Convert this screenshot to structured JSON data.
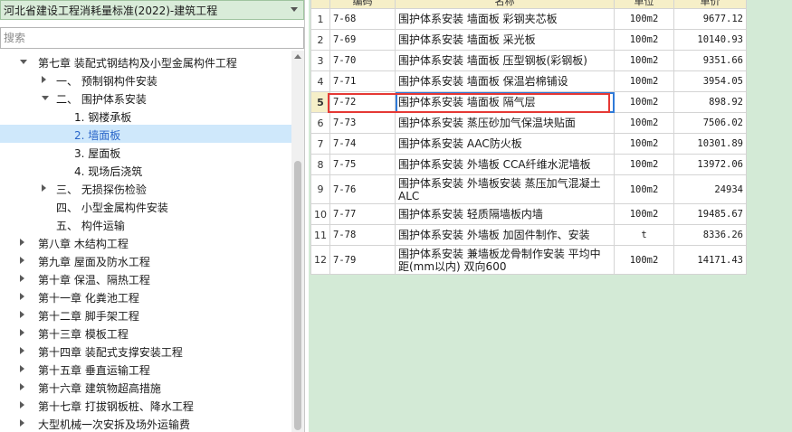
{
  "standard_select": {
    "value": "河北省建设工程消耗量标准(2022)-建筑工程"
  },
  "search": {
    "placeholder": "搜索"
  },
  "tree": [
    {
      "label": "第七章 装配式钢结构及小型金属构件工程",
      "expanded": true
    },
    {
      "label": "一、 预制钢构件安装",
      "expanded": false
    },
    {
      "label": "二、 围护体系安装",
      "expanded": true
    },
    {
      "label": "1. 钢楼承板"
    },
    {
      "label": "2. 墙面板",
      "selected": true
    },
    {
      "label": "3. 屋面板"
    },
    {
      "label": "4. 现场后浇筑"
    },
    {
      "label": "三、 无损探伤检验",
      "expanded": false
    },
    {
      "label": "四、 小型金属构件安装"
    },
    {
      "label": "五、 构件运输"
    },
    {
      "label": "第八章 木结构工程",
      "expanded": false
    },
    {
      "label": "第九章 屋面及防水工程",
      "expanded": false
    },
    {
      "label": "第十章 保温、隔热工程",
      "expanded": false
    },
    {
      "label": "第十一章 化粪池工程",
      "expanded": false
    },
    {
      "label": "第十二章 脚手架工程",
      "expanded": false
    },
    {
      "label": "第十三章 模板工程",
      "expanded": false
    },
    {
      "label": "第十四章 装配式支撑安装工程",
      "expanded": false
    },
    {
      "label": "第十五章 垂直运输工程",
      "expanded": false
    },
    {
      "label": "第十六章 建筑物超高措施",
      "expanded": false
    },
    {
      "label": "第十七章 打拔钢板桩、降水工程",
      "expanded": false
    },
    {
      "label": "大型机械一次安拆及场外运输费",
      "expanded": false
    }
  ],
  "table": {
    "headers": {
      "code": "编码",
      "name": "名称",
      "unit": "单位",
      "price": "单价"
    },
    "rows": [
      {
        "idx": "1",
        "code": "7-68",
        "name": "围护体系安装 墙面板 彩钢夹芯板",
        "unit": "100m2",
        "price": "9677.12"
      },
      {
        "idx": "2",
        "code": "7-69",
        "name": "围护体系安装 墙面板 采光板",
        "unit": "100m2",
        "price": "10140.93"
      },
      {
        "idx": "3",
        "code": "7-70",
        "name": "围护体系安装 墙面板 压型钢板(彩钢板)",
        "unit": "100m2",
        "price": "9351.66"
      },
      {
        "idx": "4",
        "code": "7-71",
        "name": "围护体系安装 墙面板 保温岩棉铺设",
        "unit": "100m2",
        "price": "3954.05"
      },
      {
        "idx": "5",
        "code": "7-72",
        "name": "围护体系安装 墙面板 隔气层",
        "unit": "100m2",
        "price": "898.92",
        "current": true
      },
      {
        "idx": "6",
        "code": "7-73",
        "name": "围护体系安装 蒸压砂加气保温块贴面",
        "unit": "100m2",
        "price": "7506.02"
      },
      {
        "idx": "7",
        "code": "7-74",
        "name": "围护体系安装 AAC防火板",
        "unit": "100m2",
        "price": "10301.89"
      },
      {
        "idx": "8",
        "code": "7-75",
        "name": "围护体系安装 外墙板 CCA纤维水泥墙板",
        "unit": "100m2",
        "price": "13972.06"
      },
      {
        "idx": "9",
        "code": "7-76",
        "name": "围护体系安装 外墙板安装 蒸压加气混凝土ALC",
        "unit": "100m2",
        "price": "24934",
        "tall": true
      },
      {
        "idx": "10",
        "code": "7-77",
        "name": "围护体系安装 轻质隔墙板内墙",
        "unit": "100m2",
        "price": "19485.67"
      },
      {
        "idx": "11",
        "code": "7-78",
        "name": "围护体系安装 外墙板 加固件制作、安装",
        "unit": "t",
        "price": "8336.26"
      },
      {
        "idx": "12",
        "code": "7-79",
        "name": "围护体系安装 兼墙板龙骨制作安装 平均中距(mm以内) 双向600",
        "unit": "100m2",
        "price": "14171.43",
        "tall": true
      }
    ]
  }
}
